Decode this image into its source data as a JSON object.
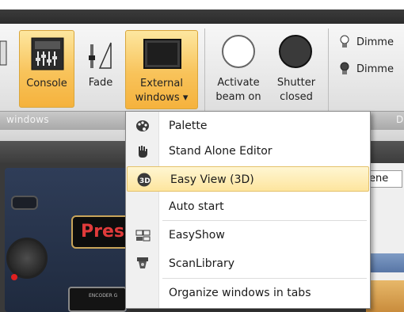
{
  "ribbon": {
    "buttons": [
      {
        "label": "Console"
      },
      {
        "label": "Fade"
      },
      {
        "label_line1": "External",
        "label_line2": "windows ▾"
      },
      {
        "label_line1": "Activate",
        "label_line2": "beam on"
      },
      {
        "label_line1": "Shutter",
        "label_line2": "closed"
      }
    ],
    "dimmer_items": [
      "Dimme",
      "Dimme"
    ],
    "group_label": "windows",
    "right_group_label": "D"
  },
  "menu": {
    "items": [
      {
        "label": "Palette",
        "icon": "palette-icon",
        "highlighted": false
      },
      {
        "label": "Stand Alone Editor",
        "icon": "hand-icon",
        "highlighted": false
      },
      {
        "label": "Easy View (3D)",
        "icon": "3d-icon",
        "highlighted": true
      },
      {
        "label": "Auto start",
        "icon": "",
        "highlighted": false
      },
      {
        "label": "EasyShow",
        "icon": "easyshow-icon",
        "highlighted": false
      },
      {
        "label": "ScanLibrary",
        "icon": "scanlibrary-icon",
        "highlighted": false
      },
      {
        "label": "Organize windows in tabs",
        "icon": "",
        "highlighted": false
      }
    ]
  },
  "background": {
    "scene_tab": "ene",
    "preset_label": "Pres",
    "encoder_label": "ENCODER G"
  },
  "colors": {
    "accent_orange": "#f8c35a",
    "highlight": "#fde59e",
    "preset_text": "#e13b3b"
  }
}
